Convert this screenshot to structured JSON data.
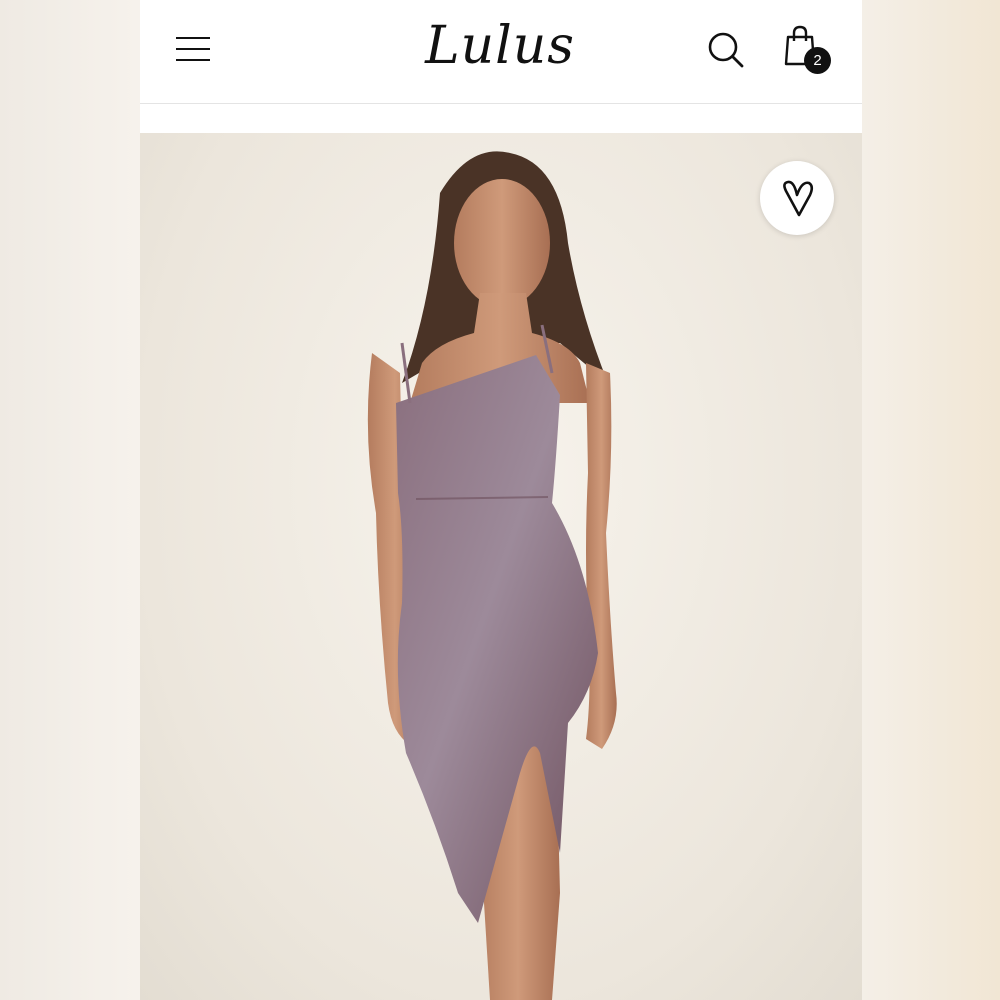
{
  "header": {
    "logo_text": "Lulus",
    "cart_count": "2",
    "icons": {
      "menu": "hamburger-menu-icon",
      "search": "search-icon",
      "cart": "shopping-bag-icon"
    }
  },
  "product": {
    "image_description_icon": "product-photo",
    "wishlist_icon": "heart-icon"
  },
  "colors": {
    "text": "#111111",
    "header_bg": "#ffffff",
    "photo_bg": "#ece6dc",
    "dress": "#7d5a66"
  }
}
